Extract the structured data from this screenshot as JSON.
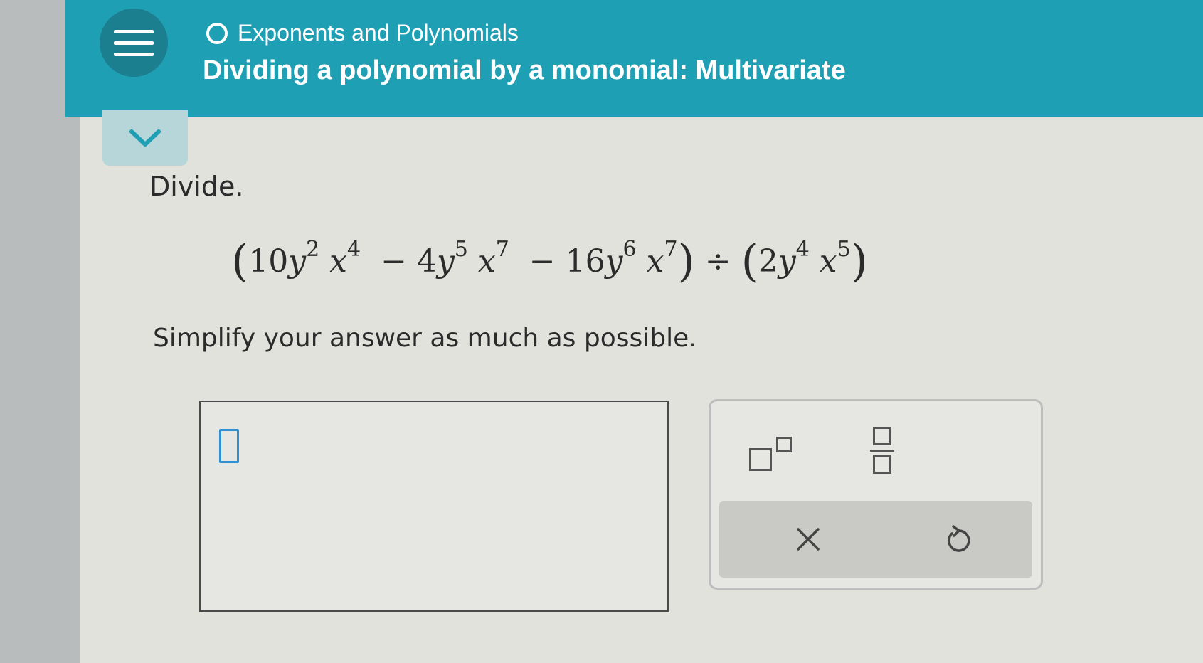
{
  "header": {
    "topic": "Exponents and Polynomials",
    "title": "Dividing a polynomial by a monomial: Multivariate"
  },
  "problem": {
    "instruction": "Divide.",
    "open_paren": "(",
    "close_paren": ")",
    "divide_sign": "÷",
    "terms": [
      {
        "coef": "10",
        "var1": "y",
        "exp1": "2",
        "var2": "x",
        "exp2": "4"
      },
      {
        "sign": "−",
        "coef": "4",
        "var1": "y",
        "exp1": "5",
        "var2": "x",
        "exp2": "7"
      },
      {
        "sign": "−",
        "coef": "16",
        "var1": "y",
        "exp1": "6",
        "var2": "x",
        "exp2": "7"
      }
    ],
    "divisor": {
      "coef": "2",
      "var1": "y",
      "exp1": "4",
      "var2": "x",
      "exp2": "5"
    },
    "simplify": "Simplify your answer as much as possible."
  },
  "tools": {
    "clear_symbol": "×",
    "undo_icon": "undo-icon"
  },
  "colors": {
    "header": "#1f9fb3",
    "menu": "#1b7f8f",
    "accent": "#2f8fcf"
  }
}
